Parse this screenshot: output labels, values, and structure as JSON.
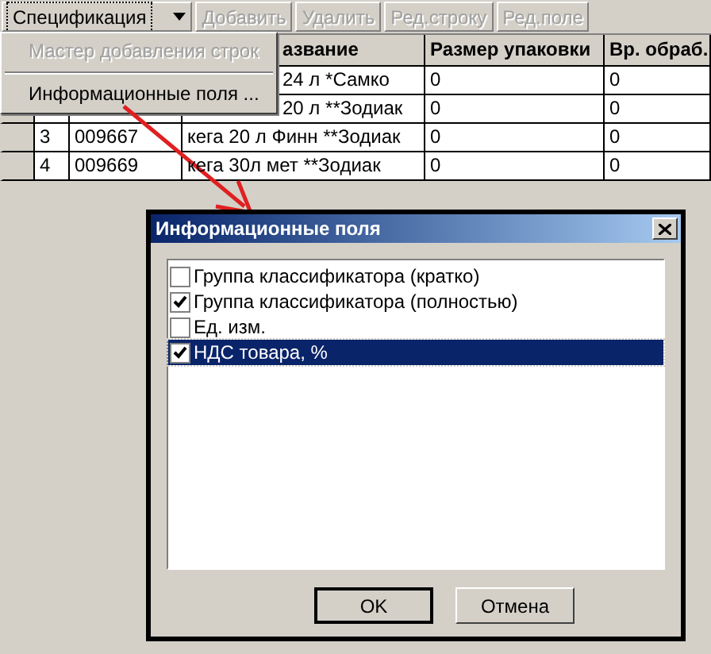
{
  "toolbar": {
    "buttons": [
      {
        "label": "Спецификация",
        "disabled": false,
        "dropdown": true
      },
      {
        "label": "Добавить",
        "disabled": true,
        "dropdown": false
      },
      {
        "label": "Удалить",
        "disabled": true,
        "dropdown": false
      },
      {
        "label": "Ред.строку",
        "disabled": true,
        "dropdown": false
      },
      {
        "label": "Ред.поле",
        "disabled": true,
        "dropdown": false
      }
    ]
  },
  "menu": {
    "items": [
      {
        "label": "Мастер добавления строк",
        "disabled": true
      },
      {
        "label": "Информационные поля ...",
        "disabled": false
      }
    ]
  },
  "table": {
    "columns": [
      "азвание",
      "Размер упаковки",
      "Вр. обраб."
    ],
    "rows": [
      {
        "name": "24 л  *Самко",
        "size": "0",
        "time": "0"
      },
      {
        "name": "20 л  **Зодиак",
        "size": "0",
        "time": "0"
      },
      {
        "number": "3",
        "code": "009667",
        "name": "кега 20 л Финн **Зодиак",
        "size": "0",
        "time": "0"
      },
      {
        "number": "4",
        "code": "009669",
        "name": "кега 30л мет **Зодиак",
        "size": "0",
        "time": "0"
      }
    ]
  },
  "dialog": {
    "title": "Информационные поля",
    "items": [
      {
        "label": "Группа классификатора (кратко)",
        "checked": false,
        "selected": false
      },
      {
        "label": "Группа классификатора (полностью)",
        "checked": true,
        "selected": false
      },
      {
        "label": "Ед. изм.",
        "checked": false,
        "selected": false
      },
      {
        "label": "НДС товара, %",
        "checked": true,
        "selected": true
      }
    ],
    "buttons": [
      {
        "label": "OK",
        "default": true
      },
      {
        "label": "Отмена",
        "default": false
      }
    ]
  }
}
